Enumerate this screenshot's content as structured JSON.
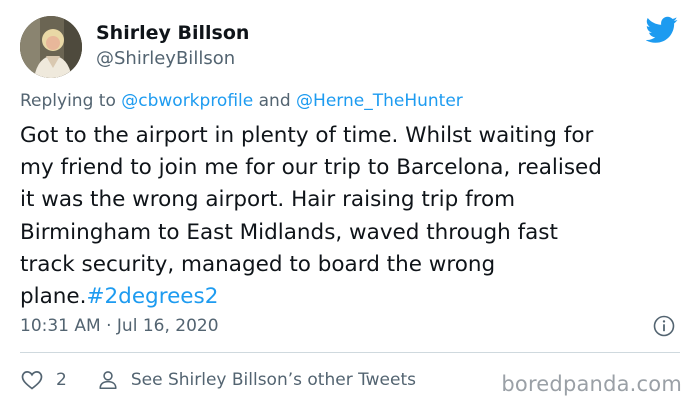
{
  "tweet": {
    "author_name": "Shirley Billson",
    "author_handle": "@ShirleyBillson",
    "avatar_icon": "profile-photo",
    "reply_prefix": "Replying to ",
    "reply_mention_1": "@cbworkprofile",
    "reply_and": " and ",
    "reply_mention_2": "@Herne_TheHunter",
    "text_lines": [
      "Got to the airport in plenty of time. Whilst waiting for",
      "my friend to join me for our trip to Barcelona, realised",
      "it was the wrong airport. Hair raising trip from",
      "Birmingham to East Midlands, waved through fast",
      "track security, managed to board the wrong",
      "plane."
    ],
    "hashtag": "#2degrees2",
    "timestamp": "10:31 AM · Jul 16, 2020",
    "like_count": "2",
    "profile_link": "See Shirley Billson’s other Tweets"
  },
  "icons": {
    "brand": "twitter-bird-icon",
    "info": "info-icon",
    "like": "heart-icon",
    "profile": "person-icon"
  },
  "colors": {
    "twitter_blue": "#1d9bf0",
    "text_primary": "#0f1419",
    "text_secondary": "#536471",
    "divider": "#cfd9de"
  },
  "watermark": {
    "text": "boredpanda.com"
  }
}
